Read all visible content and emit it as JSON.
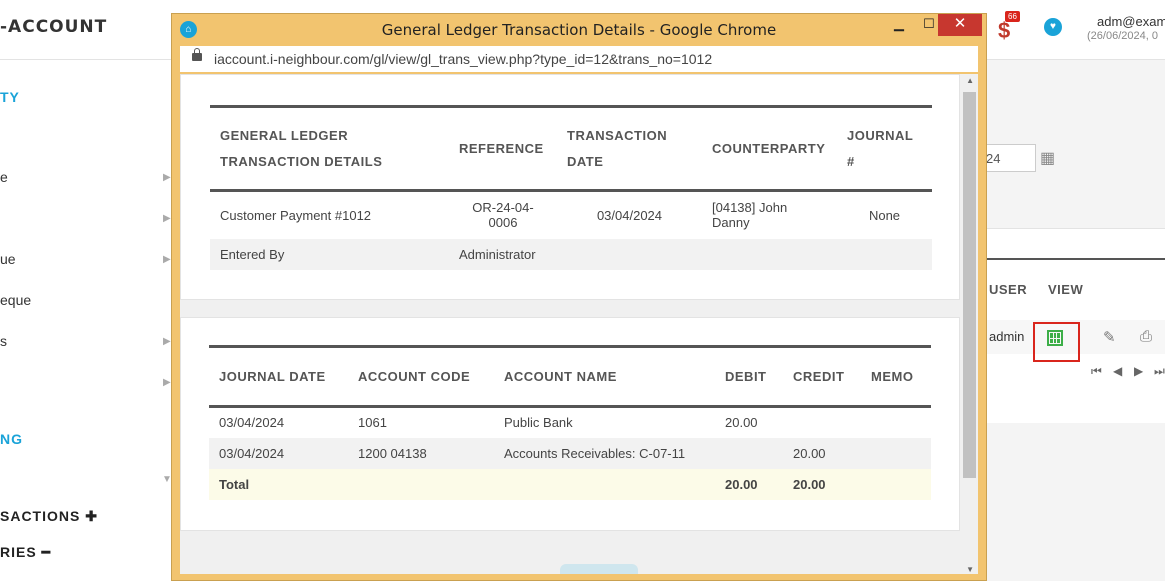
{
  "background": {
    "brand": "-ACCOUNT",
    "notification_count": "66",
    "user": "adm@exam",
    "user_date": "(26/06/2024, 0",
    "sidebar": [
      {
        "label": "TY",
        "style": "blue"
      },
      {
        "label": "e",
        "style": "normal",
        "arrow": true
      },
      {
        "label": "",
        "style": "normal",
        "arrow": true
      },
      {
        "label": "ue",
        "style": "normal",
        "arrow": true
      },
      {
        "label": "eque",
        "style": "normal",
        "arrow": false
      },
      {
        "label": "s",
        "style": "normal",
        "arrow": true
      },
      {
        "label": "",
        "style": "normal",
        "arrow": true
      },
      {
        "label": "NG",
        "style": "blue"
      },
      {
        "label": "SACTIONS ✚",
        "style": "bold"
      },
      {
        "label": "RIES ━",
        "style": "bold"
      }
    ],
    "date_input_value": "24",
    "table_headers": [
      "USER",
      "VIEW"
    ],
    "row_user": "admin"
  },
  "popup": {
    "title": "General Ledger Transaction Details - Google Chrome",
    "url": "iaccount.i-neighbour.com/gl/view/gl_trans_view.php?type_id=12&trans_no=1012",
    "summary": {
      "headers": [
        "GENERAL LEDGER TRANSACTION DETAILS",
        "REFERENCE",
        "TRANSACTION DATE",
        "COUNTERPARTY",
        "JOURNAL #"
      ],
      "row": {
        "description": "Customer Payment #1012",
        "reference": "OR-24-04-0006",
        "transaction_date": "03/04/2024",
        "counterparty": "[04138] John Danny",
        "journal": "None"
      },
      "entered_by_label": "Entered By",
      "entered_by_value": "Administrator"
    },
    "entries": {
      "headers": [
        "JOURNAL DATE",
        "ACCOUNT CODE",
        "ACCOUNT NAME",
        "DEBIT",
        "CREDIT",
        "MEMO"
      ],
      "rows": [
        {
          "date": "03/04/2024",
          "code": "1061",
          "name": "Public Bank",
          "debit": "20.00",
          "credit": "",
          "memo": ""
        },
        {
          "date": "03/04/2024",
          "code": "1200 04138",
          "name": "Accounts Receivables: C-07-11",
          "debit": "",
          "credit": "20.00",
          "memo": ""
        }
      ],
      "total_label": "Total",
      "total_debit": "20.00",
      "total_credit": "20.00"
    }
  }
}
